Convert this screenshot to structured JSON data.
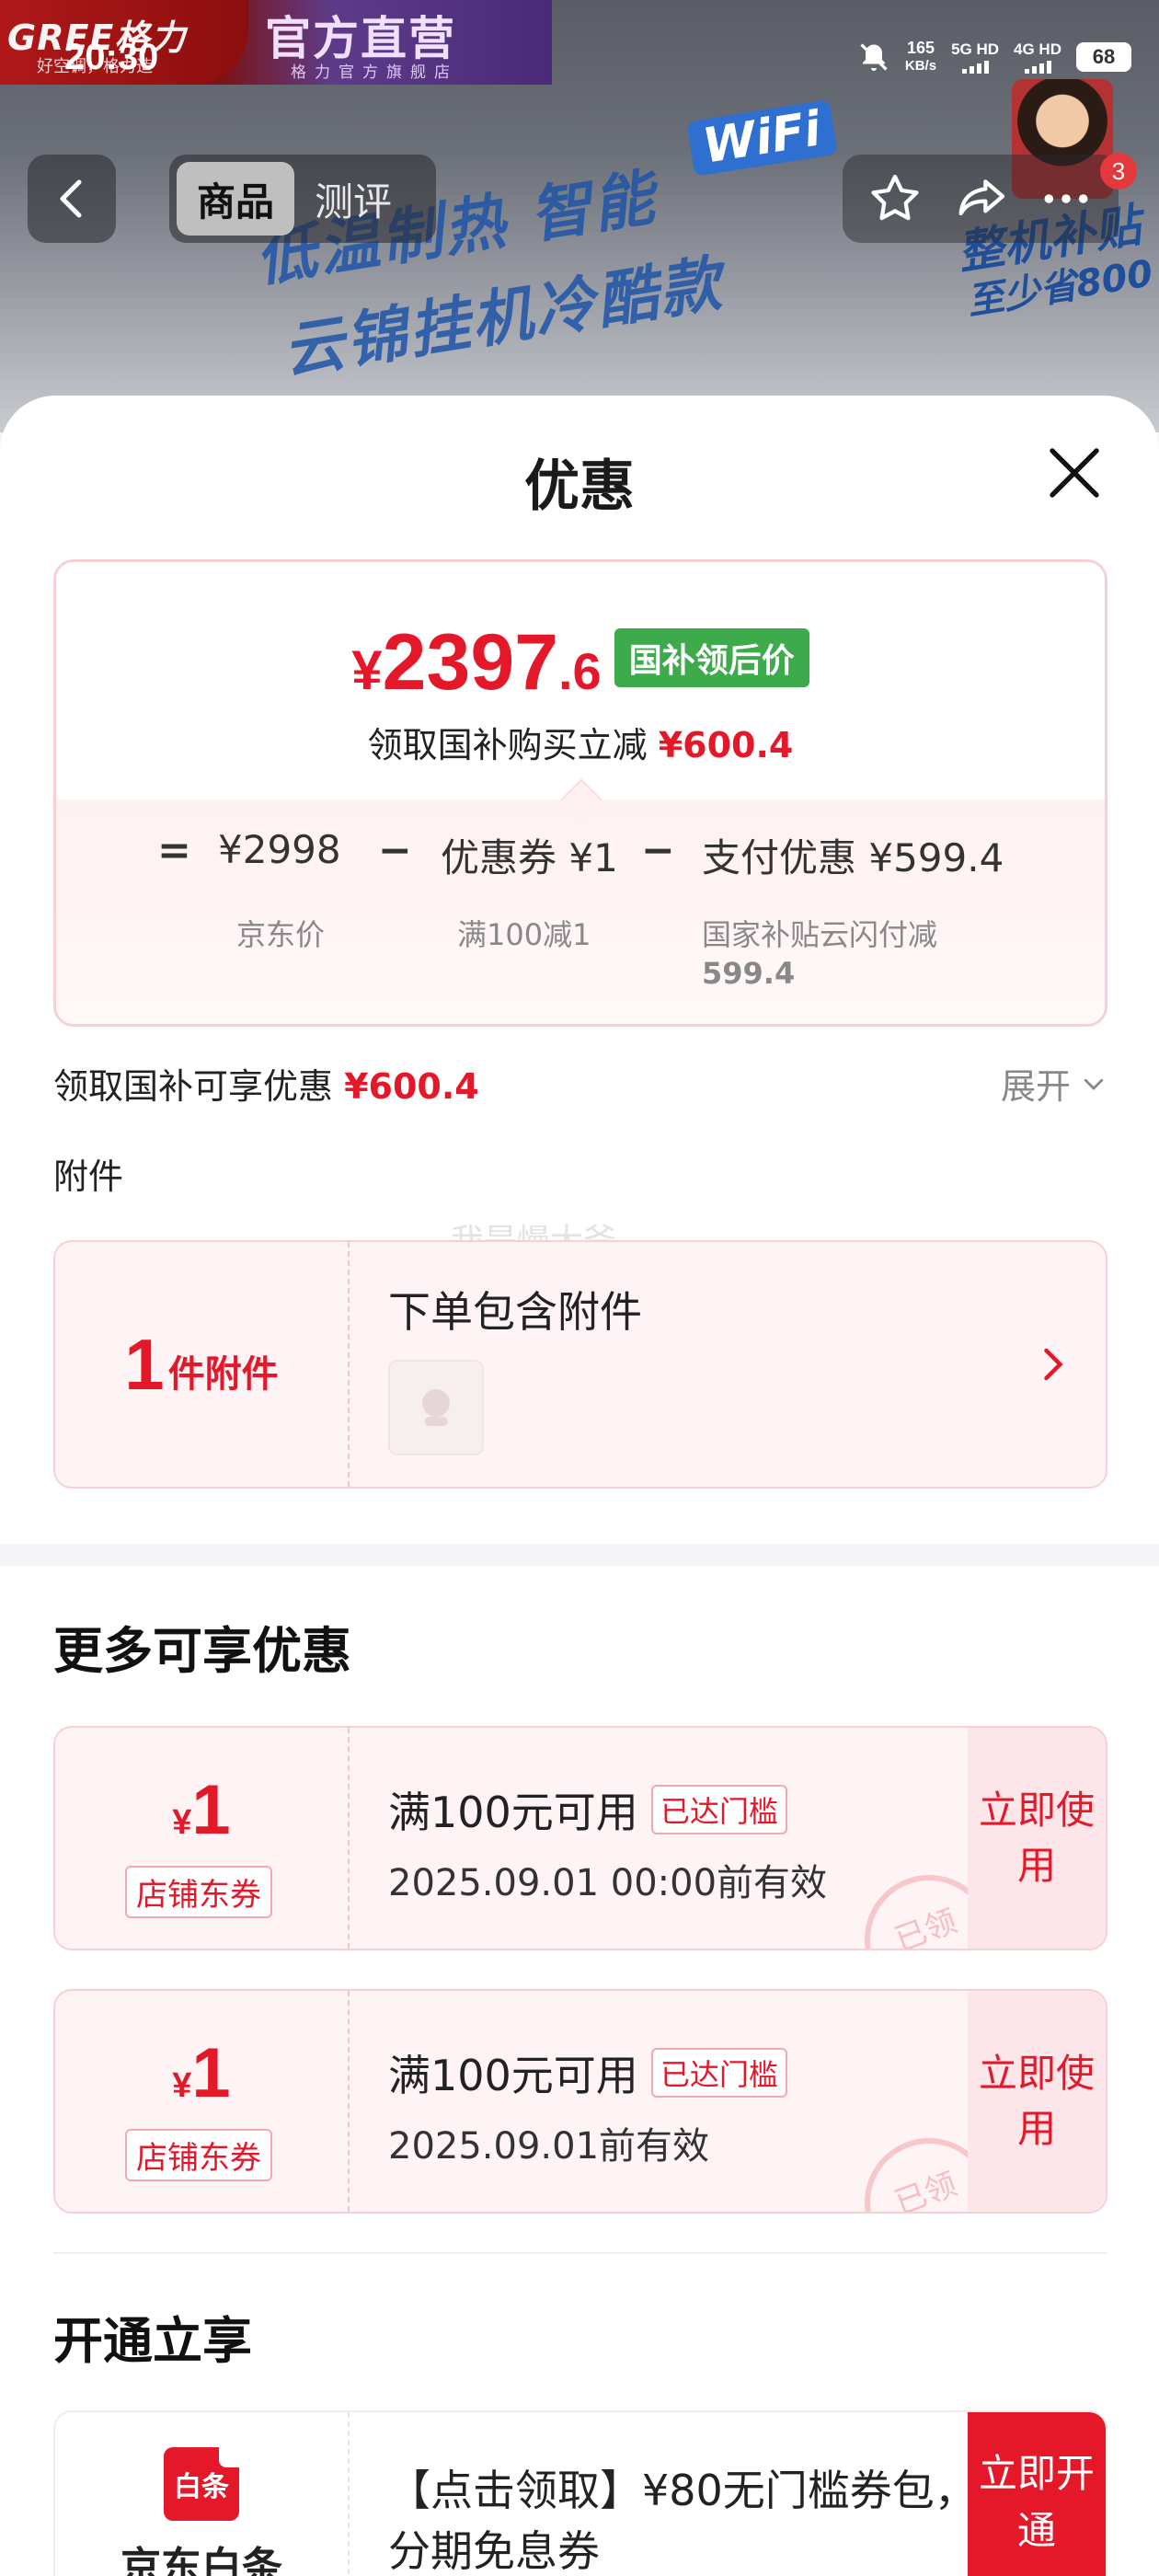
{
  "status_bar": {
    "time": "20:30",
    "net_speed": "165",
    "net_unit": "KB/s",
    "sim1": "5G HD",
    "sim2": "4G HD",
    "battery": "68"
  },
  "banner": {
    "brand": "GREE格力",
    "brand_sub": "好空调，格力造",
    "store_title": "官方直营",
    "store_sub": "格力官方旗舰店",
    "promo_line1": "低温制热 智能",
    "promo_wifi": "WiFi",
    "promo_line2": "云锦挂机冷酷款",
    "promo_badge1": "整机补贴",
    "promo_badge2": "至少省800"
  },
  "nav": {
    "tabs": [
      "商品",
      "测评"
    ],
    "cart_badge": "3"
  },
  "sheet": {
    "title": "优惠",
    "price": {
      "yen": "¥",
      "int": "2397",
      "dec": ".6",
      "tag": "国补领后价",
      "save_text": "领取国补购买立减",
      "save_amount": "¥600.4"
    },
    "formula": {
      "eq": "=",
      "minus": "−",
      "jd_price": "¥2998",
      "jd_price_label": "京东价",
      "coupon": "优惠券 ¥1",
      "coupon_label": "满100减1",
      "pay": "支付优惠 ¥599.4",
      "pay_label_1": "国家补贴云闪付减",
      "pay_label_2": "599.4"
    },
    "expand": {
      "text": "领取国补可享优惠",
      "amount": "¥600.4",
      "toggle": "展开"
    },
    "attachments": {
      "label": "附件",
      "count": "1",
      "count_unit": "件附件",
      "title": "下单包含附件",
      "thumb_alt": "京东"
    },
    "watermark": "我是慢大爷",
    "more_title": "更多可享优惠",
    "coupons": [
      {
        "yen": "¥",
        "amount": "1",
        "type": "店铺东券",
        "condition": "满100元可用",
        "tag": "已达门槛",
        "valid": "2025.09.01 00:00前有效",
        "action": "立即使用",
        "stamp": "已领"
      },
      {
        "yen": "¥",
        "amount": "1",
        "type": "店铺东券",
        "condition": "满100元可用",
        "tag": "已达门槛",
        "valid": "2025.09.01前有效",
        "action": "立即使用",
        "stamp": "已领"
      }
    ],
    "open_title": "开通立享",
    "baitiao": {
      "icon_text": "白条",
      "name": "京东白条",
      "text": "【点击领取】¥80无门槛券包，分期免息券",
      "action": "立即开通"
    }
  },
  "colors": {
    "accent_red": "#e5182a",
    "tag_green": "#3daa4c",
    "card_bg": "#fff4f5"
  }
}
